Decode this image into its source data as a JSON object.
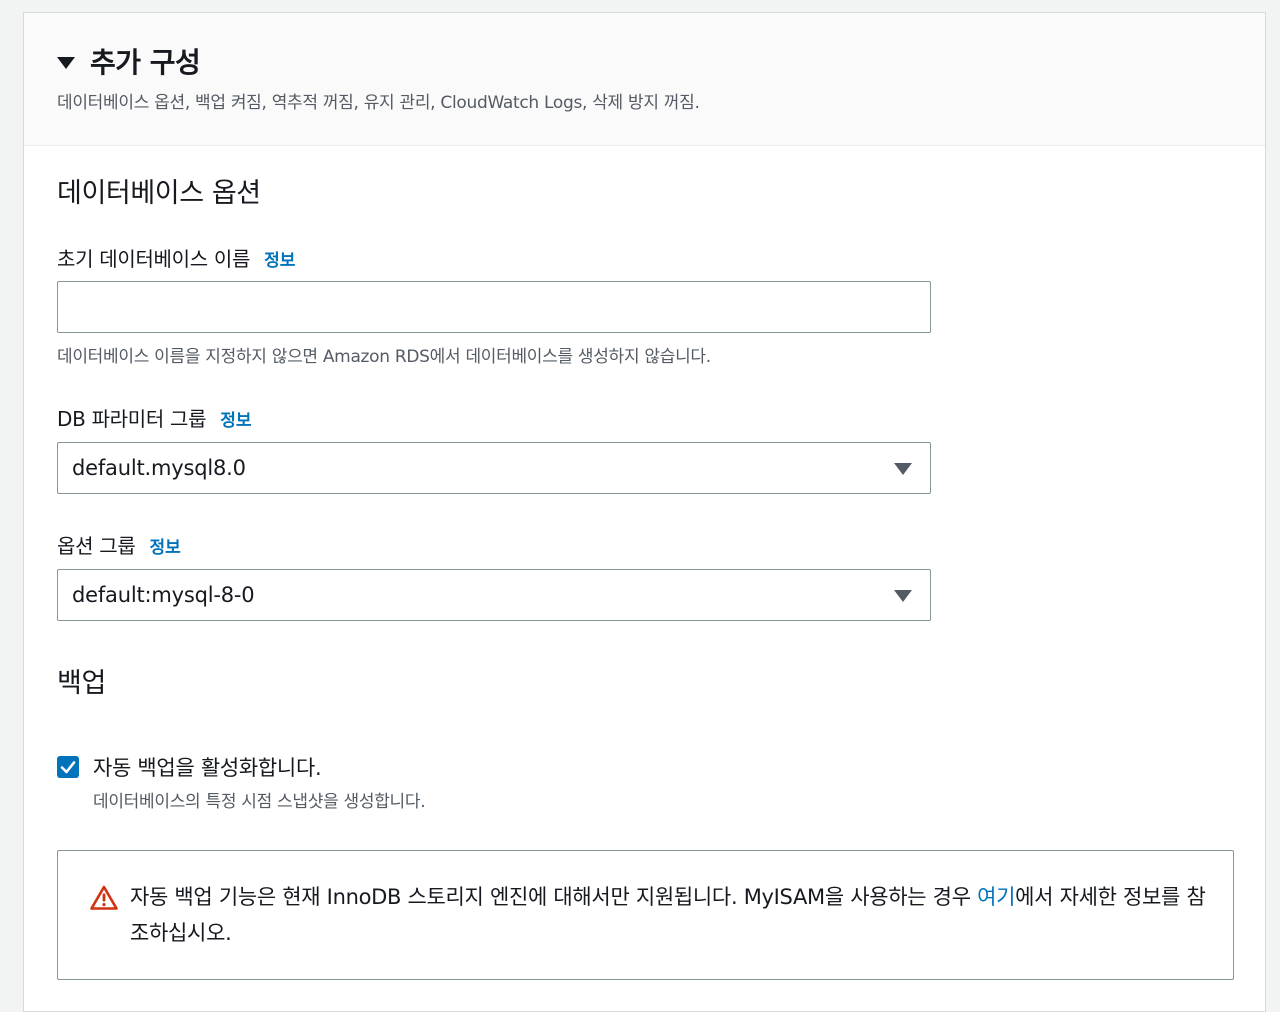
{
  "header": {
    "title": "추가 구성",
    "description": "데이터베이스 옵션, 백업 켜짐, 역추적 꺼짐, 유지 관리, CloudWatch Logs, 삭제 방지 꺼짐."
  },
  "database_options": {
    "section_title": "데이터베이스 옵션",
    "initial_db_name": {
      "label": "초기 데이터베이스 이름",
      "info": "정보",
      "value": "",
      "description": "데이터베이스 이름을 지정하지 않으면 Amazon RDS에서 데이터베이스를 생성하지 않습니다."
    },
    "db_parameter_group": {
      "label": "DB 파라미터 그룹",
      "info": "정보",
      "selected": "default.mysql8.0"
    },
    "option_group": {
      "label": "옵션 그룹",
      "info": "정보",
      "selected": "default:mysql-8-0"
    }
  },
  "backup": {
    "section_title": "백업",
    "auto_backup": {
      "checked": true,
      "label": "자동 백업을 활성화합니다.",
      "description": "데이터베이스의 특정 시점 스냅샷을 생성합니다."
    },
    "alert": {
      "icon": "warning-icon",
      "text_before": "자동 백업 기능은 현재 InnoDB 스토리지 엔진에 대해서만 지원됩니다. MyISAM을 사용하는 경우 ",
      "link": "여기",
      "text_after": "에서 자세한 정보를 참조하십시오."
    }
  },
  "colors": {
    "accent": "#0073bb",
    "warning": "#d13212",
    "border": "#879596"
  }
}
